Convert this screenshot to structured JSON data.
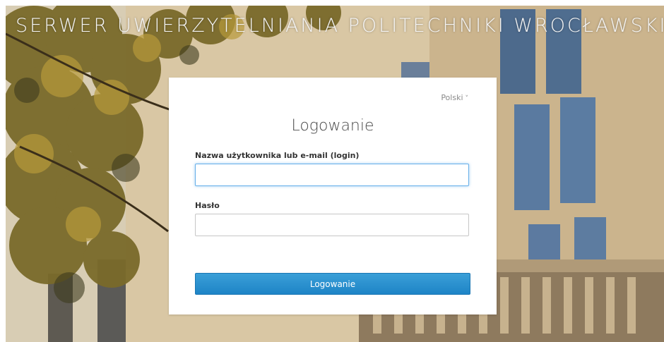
{
  "header": {
    "title": "SERWER UWIERZYTELNIANIA POLITECHNIKI WROCŁAWSKIEJ"
  },
  "login": {
    "language": "Polski",
    "heading": "Logowanie",
    "username_label": "Nazwa użytkownika lub e-mail (login)",
    "username_value": "",
    "password_label": "Hasło",
    "password_value": "",
    "submit_label": "Logowanie"
  },
  "colors": {
    "primary_button": "#2a93d5",
    "focus_border": "#66afe9"
  }
}
